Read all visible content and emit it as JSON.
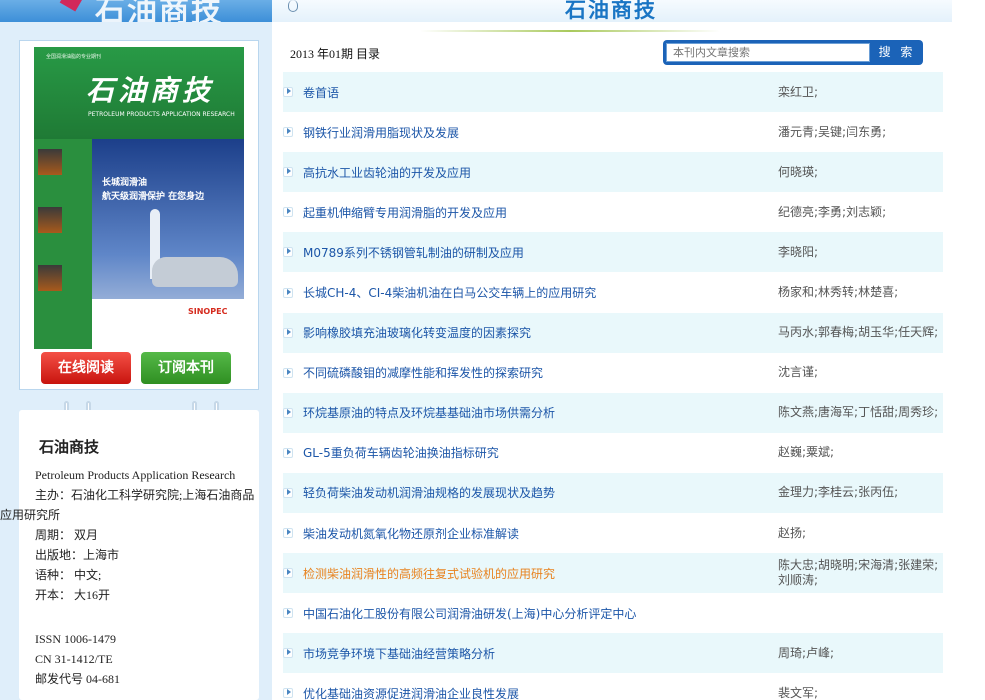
{
  "site": {
    "logo_text": "石油商技",
    "header_title": "石油商技"
  },
  "cover": {
    "tagline": "全国润滑油脂的专业期刊",
    "title": "石油商技",
    "subtitle": "PETROLEUM PRODUCTS APPLICATION RESEARCH",
    "ad_line1": "长城润滑油",
    "ad_line2": "航天级润滑保护 在您身边",
    "brand": "SINOPEC"
  },
  "buttons": {
    "read_online": "在线阅读",
    "subscribe": "订阅本刊"
  },
  "journal_info": {
    "name": "石油商技",
    "english_name": "Petroleum Products Application Research",
    "sponsor_line1": "主办：石油化工科学研究院;上海石油商品",
    "sponsor_line2": "应用研究所",
    "frequency": "周期：  双月",
    "location": "出版地：上海市",
    "language": "语种：  中文;",
    "format": "开本：  大16开",
    "issn": "ISSN 1006-1479",
    "cn": "CN 31-1412/TE",
    "postal_code": "邮发代号 04-681"
  },
  "issue": {
    "label": "2013 年01期 目录"
  },
  "search": {
    "placeholder": "本刊内文章搜索",
    "button_label": "搜 索"
  },
  "articles": [
    {
      "title": "卷首语",
      "authors": "栾红卫;"
    },
    {
      "title": "钢铁行业润滑用脂现状及发展",
      "authors": "潘元青;吴键;闫东勇;"
    },
    {
      "title": "高抗水工业齿轮油的开发及应用",
      "authors": "何晓瑛;"
    },
    {
      "title": "起重机伸缩臂专用润滑脂的开发及应用",
      "authors": "纪德亮;李勇;刘志颖;"
    },
    {
      "title": "M0789系列不锈钢管轧制油的研制及应用",
      "authors": "李晓阳;"
    },
    {
      "title": "长城CH-4、CI-4柴油机油在白马公交车辆上的应用研究",
      "authors": "杨家和;林秀转;林楚喜;"
    },
    {
      "title": "影响橡胶填充油玻璃化转变温度的因素探究",
      "authors": "马丙水;郭春梅;胡玉华;任天辉;"
    },
    {
      "title": "不同硫磷酸钼的减摩性能和挥发性的探索研究",
      "authors": "沈言谨;"
    },
    {
      "title": "环烷基原油的特点及环烷基基础油市场供需分析",
      "authors": "陈文燕;唐海军;丁恬甜;周秀珍;"
    },
    {
      "title": "GL-5重负荷车辆齿轮油换油指标研究",
      "authors": "赵巍;粟斌;"
    },
    {
      "title": "轻负荷柴油发动机润滑油规格的发展现状及趋势",
      "authors": "金理力;李桂云;张丙伍;"
    },
    {
      "title": "柴油发动机氮氧化物还原剂企业标准解读",
      "authors": "赵扬;"
    },
    {
      "title": "检测柴油润滑性的高频往复式试验机的应用研究",
      "authors": "陈大忠;胡晓明;宋海清;张建荣;刘顺涛;",
      "highlight": true
    },
    {
      "title": "中国石油化工股份有限公司润滑油研发(上海)中心分析评定中心",
      "authors": ""
    },
    {
      "title": "市场竞争环境下基础油经营策略分析",
      "authors": "周琦;卢峰;"
    },
    {
      "title": "优化基础油资源促进润滑油企业良性发展",
      "authors": "裴文军;"
    }
  ]
}
